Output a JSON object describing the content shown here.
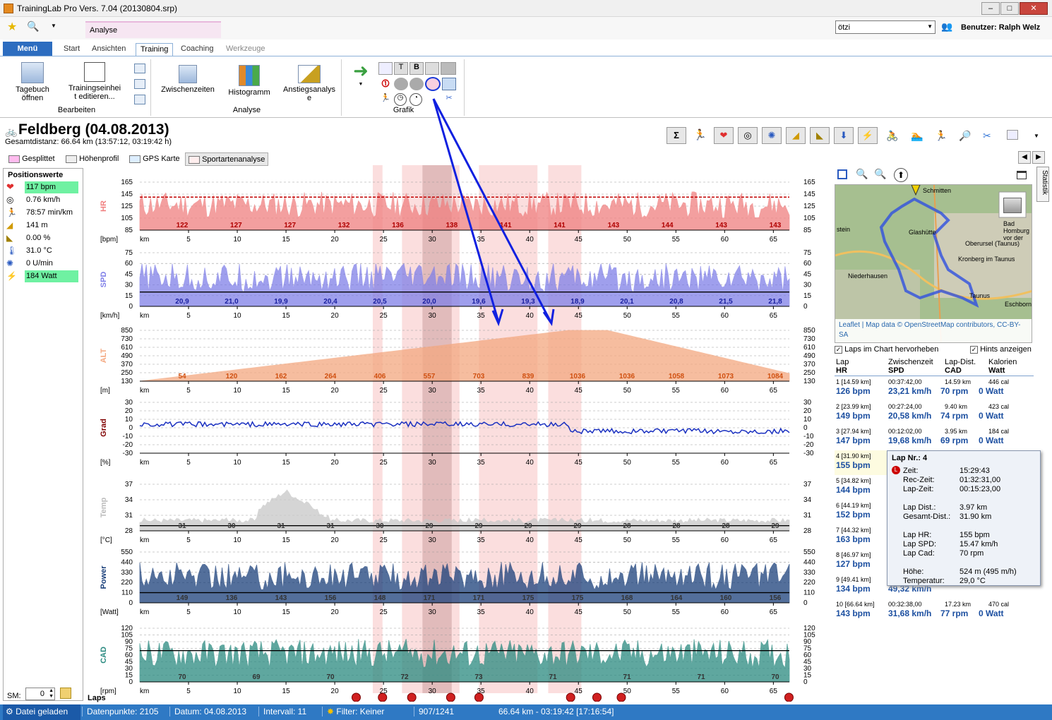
{
  "window": {
    "title": "TrainingLab Pro Vers. 7.04 (20130804.srp)"
  },
  "quickaccess": {
    "user_select": "ötzi",
    "user_label": "Benutzer: Ralph Welz",
    "context_tab": "Analyse"
  },
  "menu": {
    "menu_label": "Menü",
    "tabs": [
      "Start",
      "Ansichten",
      "Training",
      "Coaching",
      "Werkzeuge"
    ]
  },
  "ribbon": {
    "tagebuch": "Tagebuch öffnen",
    "trainingseinheit": "Trainingseinhei t editieren...",
    "zwischenzeiten": "Zwischenzeiten",
    "histogramm": "Histogramm",
    "anstiegsanalyse": "Anstiegsanalys e",
    "groups": [
      "Bearbeiten",
      "Analyse",
      "Grafik"
    ]
  },
  "header": {
    "title": "Feldberg (04.08.2013)",
    "subtitle": "Gesamtdistanz: 66.64 km (13:57:12, 03:19:42 h)"
  },
  "subtabs": [
    "Gesplittet",
    "Höhenprofil",
    "GPS Karte",
    "Sportartenanalyse"
  ],
  "positions": {
    "title": "Positionswerte",
    "values": [
      "117 bpm",
      "0.76 km/h",
      "78:57 min/km",
      "141 m",
      "0.00 %",
      "31.0 °C",
      "0 U/min",
      "184 Watt"
    ],
    "sm_label": "SM:",
    "sm_value": "0"
  },
  "colors": {
    "hr": "#f08080",
    "spd": "#8080e8",
    "alt": "#f4a880",
    "grad": "#800000",
    "temp": "#c8c8c8",
    "power": "#1a3f7a",
    "cad": "#2a8a80",
    "lap_hilite": "#f8c8c8"
  },
  "chart_data": {
    "type": "line",
    "x_axis": {
      "label": "km",
      "ticks": [
        5,
        10,
        15,
        20,
        25,
        30,
        35,
        40,
        45,
        50,
        55,
        60,
        65
      ],
      "range": [
        0,
        66.64
      ]
    },
    "lap_highlights_km": [
      [
        23.9,
        24.9
      ],
      [
        26.9,
        32.8
      ],
      [
        34.8,
        40.8
      ],
      [
        41.9,
        45.3
      ]
    ],
    "lap_dark_km": [
      [
        29,
        32
      ]
    ],
    "panels": [
      {
        "name": "HR",
        "unit": "[bpm]",
        "ticks": [
          85,
          105,
          125,
          145,
          165
        ],
        "lap_values": [
          "122",
          "127",
          "127",
          "132",
          "136",
          "138",
          "141",
          "141",
          "143",
          "144",
          "143",
          "143"
        ],
        "avg_line": 140
      },
      {
        "name": "SPD",
        "unit": "[km/h]",
        "ticks": [
          0,
          15,
          30,
          45,
          60,
          75
        ],
        "lap_values": [
          "20,9",
          "21,0",
          "19,9",
          "20,4",
          "20,5",
          "20,0",
          "19,6",
          "19,3",
          "18,9",
          "20,1",
          "20,8",
          "21,5",
          "21,8"
        ],
        "avg_line": 20
      },
      {
        "name": "ALT",
        "unit": "[m]",
        "ticks": [
          130,
          250,
          370,
          490,
          610,
          730,
          850
        ],
        "lap_values": [
          "54",
          "120",
          "162",
          "264",
          "406",
          "557",
          "703",
          "839",
          "1036",
          "1036",
          "1058",
          "1073",
          "1084"
        ]
      },
      {
        "name": "Grad",
        "unit": "[%]",
        "ticks": [
          -30,
          -20,
          -10,
          0,
          10,
          20,
          30
        ],
        "lap_values": []
      },
      {
        "name": "Temp",
        "unit": "[°C]",
        "ticks": [
          28,
          31,
          34,
          37
        ],
        "lap_values": [
          "31",
          "30",
          "31",
          "31",
          "30",
          "29",
          "29",
          "29",
          "29",
          "28",
          "28",
          "28",
          "29"
        ],
        "avg_line": 29
      },
      {
        "name": "Power",
        "unit": "[Watt]",
        "ticks": [
          0,
          110,
          220,
          330,
          440,
          550
        ],
        "lap_values": [
          "149",
          "136",
          "143",
          "156",
          "148",
          "171",
          "171",
          "175",
          "175",
          "168",
          "164",
          "160",
          "156"
        ],
        "avg_line": 110
      },
      {
        "name": "CAD",
        "unit": "[rpm]",
        "ticks": [
          0,
          15,
          30,
          45,
          60,
          75,
          90,
          105,
          120
        ],
        "lap_values": [
          "70",
          "69",
          "70",
          "72",
          "73",
          "71",
          "71",
          "71",
          "70"
        ],
        "avg_line": 70
      }
    ]
  },
  "laps_label": "Laps",
  "map": {
    "attribution": "Leaflet | Map data © OpenStreetMap contributors, CC-BY-SA",
    "places": [
      "Schmitten",
      "Glashütte",
      "Oberursel (Taunus)",
      "Kronberg im Taunus",
      "Niederhausen",
      "Eschborn",
      "Bad Homburg vor der",
      "Taunus",
      "stein"
    ]
  },
  "checkboxes": {
    "laps": "Laps im Chart hervorheben",
    "hints": "Hints anzeigen"
  },
  "lap_table": {
    "headers": [
      "Lap",
      "Zwischenzeit",
      "Lap-Dist.",
      "Kalorien",
      "HR",
      "SPD",
      "CAD",
      "Watt"
    ],
    "rows": [
      {
        "a": "1  [14.59 km]",
        "b": "00:37:42,00",
        "c": "14.59 km",
        "d": "446 cal",
        "hr": "126 bpm",
        "spd": "23,21 km/h",
        "cad": "70 rpm",
        "w": "0 Watt"
      },
      {
        "a": "2  [23.99 km]",
        "b": "00:27:24,00",
        "c": "9.40 km",
        "d": "423 cal",
        "hr": "149 bpm",
        "spd": "20,58 km/h",
        "cad": "74 rpm",
        "w": "0 Watt"
      },
      {
        "a": "3  [27.94 km]",
        "b": "00:12:02,00",
        "c": "3.95 km",
        "d": "184 cal",
        "hr": "147 bpm",
        "spd": "19,68 km/h",
        "cad": "69 rpm",
        "w": "0 Watt"
      },
      {
        "a": "4  [31.90 km]",
        "b": "",
        "c": "",
        "d": "",
        "hr": "155 bpm",
        "spd": "",
        "cad": "",
        "w": ""
      },
      {
        "a": "5  [34.82 km]",
        "b": "",
        "c": "",
        "d": "",
        "hr": "144 bpm",
        "spd": "2",
        "cad": "",
        "w": ""
      },
      {
        "a": "6  [44.19 km]",
        "b": "",
        "c": "",
        "d": "",
        "hr": "152 bpm",
        "spd": "1",
        "cad": "",
        "w": ""
      },
      {
        "a": "7  [44.32 km]",
        "b": "",
        "c": "",
        "d": "",
        "hr": "163 bpm",
        "spd": "1",
        "cad": "",
        "w": ""
      },
      {
        "a": "8  [46.97 km]",
        "b": "",
        "c": "",
        "d": "",
        "hr": "127 bpm",
        "spd": "4",
        "cad": "",
        "w": ""
      },
      {
        "a": "9  [49.41 km]",
        "b": "",
        "c": "",
        "d": "",
        "hr": "134 bpm",
        "spd": "49,32 km/h",
        "cad": "",
        "w": ""
      },
      {
        "a": "10  [66.64 km]",
        "b": "00:32:38,00",
        "c": "17.23 km",
        "d": "470 cal",
        "hr": "143 bpm",
        "spd": "31,68 km/h",
        "cad": "77 rpm",
        "w": "0 Watt"
      }
    ]
  },
  "tooltip": {
    "title": "Lap Nr.: 4",
    "rows": [
      [
        "Zeit:",
        "15:29:43"
      ],
      [
        "Rec-Zeit:",
        "01:32:31,00"
      ],
      [
        "Lap-Zeit:",
        "00:15:23,00"
      ],
      [
        "",
        ""
      ],
      [
        "Lap Dist.:",
        "3.97 km"
      ],
      [
        "Gesamt-Dist.:",
        "31.90 km"
      ],
      [
        "",
        ""
      ],
      [
        "Lap HR:",
        "155 bpm"
      ],
      [
        "Lap SPD:",
        "15.47 km/h"
      ],
      [
        "Lap Cad:",
        "70 rpm"
      ],
      [
        "",
        ""
      ],
      [
        "Höhe:",
        "524 m (495 m/h)"
      ],
      [
        "Temperatur:",
        "29,0 °C"
      ]
    ]
  },
  "status": {
    "loaded": "Datei geladen",
    "points": "Datenpunkte: 2105",
    "date": "Datum: 04.08.2013",
    "interval": "Intervall: 11",
    "filter": "Filter: Keiner",
    "pos": "907/1241",
    "summary": "66.64 km - 03:19:42 [17:16:54]"
  },
  "side_tab": "Statistik"
}
